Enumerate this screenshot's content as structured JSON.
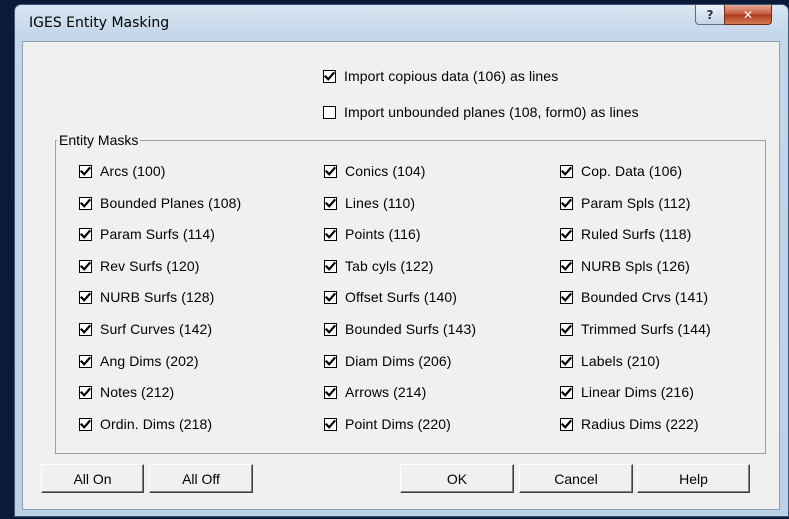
{
  "window": {
    "title": "IGES Entity Masking"
  },
  "titlebar": {
    "help_glyph": "?",
    "close_glyph": "✕"
  },
  "options": [
    {
      "label": "Import copious data (106) as lines",
      "checked": true
    },
    {
      "label": "Import unbounded planes (108, form0) as lines",
      "checked": false
    }
  ],
  "group": {
    "title": "Entity Masks"
  },
  "columns": [
    [
      "Arcs (100)",
      "Bounded Planes (108)",
      "Param Surfs (114)",
      "Rev Surfs (120)",
      "NURB Surfs (128)",
      "Surf Curves (142)",
      "Ang Dims (202)",
      "Notes (212)",
      "Ordin. Dims (218)"
    ],
    [
      "Conics (104)",
      "Lines (110)",
      "Points (116)",
      "Tab cyls (122)",
      "Offset Surfs (140)",
      "Bounded Surfs (143)",
      "Diam Dims (206)",
      "Arrows (214)",
      "Point Dims (220)"
    ],
    [
      "Cop. Data (106)",
      "Param Spls (112)",
      "Ruled Surfs (118)",
      "NURB Spls (126)",
      "Bounded Crvs (141)",
      "Trimmed Surfs (144)",
      "Labels (210)",
      "Linear Dims (216)",
      "Radius Dims (222)"
    ]
  ],
  "buttons": {
    "all_on": "All On",
    "all_off": "All Off",
    "ok": "OK",
    "cancel": "Cancel",
    "help": "Help"
  }
}
